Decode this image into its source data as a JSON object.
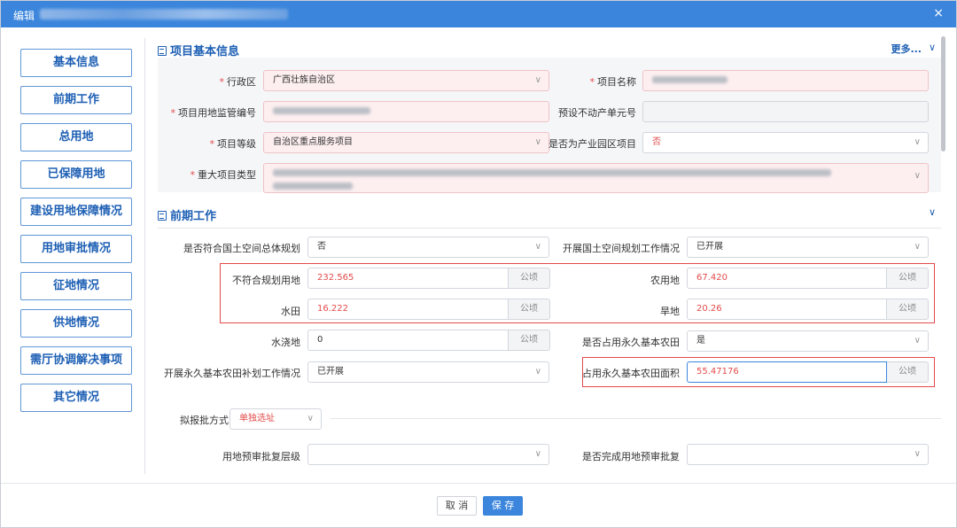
{
  "dialog": {
    "title": "编辑",
    "close_icon": "×"
  },
  "nav": [
    "基本信息",
    "前期工作",
    "总用地",
    "已保障用地",
    "建设用地保障情况",
    "用地审批情况",
    "征地情况",
    "供地情况",
    "需厅协调解决事项",
    "其它情况"
  ],
  "sec1": {
    "title": "项目基本信息",
    "more": "更多...",
    "admin_region_label": "行政区",
    "admin_region_value": "广西壮族自治区",
    "project_name_label": "项目名称",
    "land_code_label": "项目用地监管编号",
    "preset_unit_label": "预设不动产单元号",
    "level_label": "项目等级",
    "level_value": "自治区重点服务项目",
    "industrial_label": "是否为产业园区项目",
    "industrial_value": "否",
    "major_type_label": "重大项目类型"
  },
  "sec2": {
    "title": "前期工作",
    "plan_label": "是否符合国土空间总体规划",
    "plan_value": "否",
    "spatial_label": "开展国土空间规划工作情况",
    "spatial_value": "已开展",
    "nonconform_label": "不符合规划用地",
    "nonconform_value": "232.565",
    "farm_label": "农用地",
    "farm_value": "67.420",
    "paddy_label": "水田",
    "paddy_value": "16.222",
    "dry_label": "旱地",
    "dry_value": "20.26",
    "irrigated_label": "水浇地",
    "irrigated_value": "0",
    "occupy_label": "是否占用永久基本农田",
    "occupy_value": "是",
    "supplement_label": "开展永久基本农田补划工作情况",
    "supplement_value": "已开展",
    "occupy_area_label": "占用永久基本农田面积",
    "occupy_area_value": "55.47176",
    "unit": "公顷",
    "approval_label": "拟报批方式",
    "approval_value": "单独选址",
    "pre_level_label": "用地预审批复层级",
    "pre_done_label": "是否完成用地预审批复"
  },
  "footer": {
    "cancel": "取 消",
    "save": "保 存"
  },
  "colors": {
    "accent": "#3b86dc",
    "required": "#e34b4b"
  }
}
